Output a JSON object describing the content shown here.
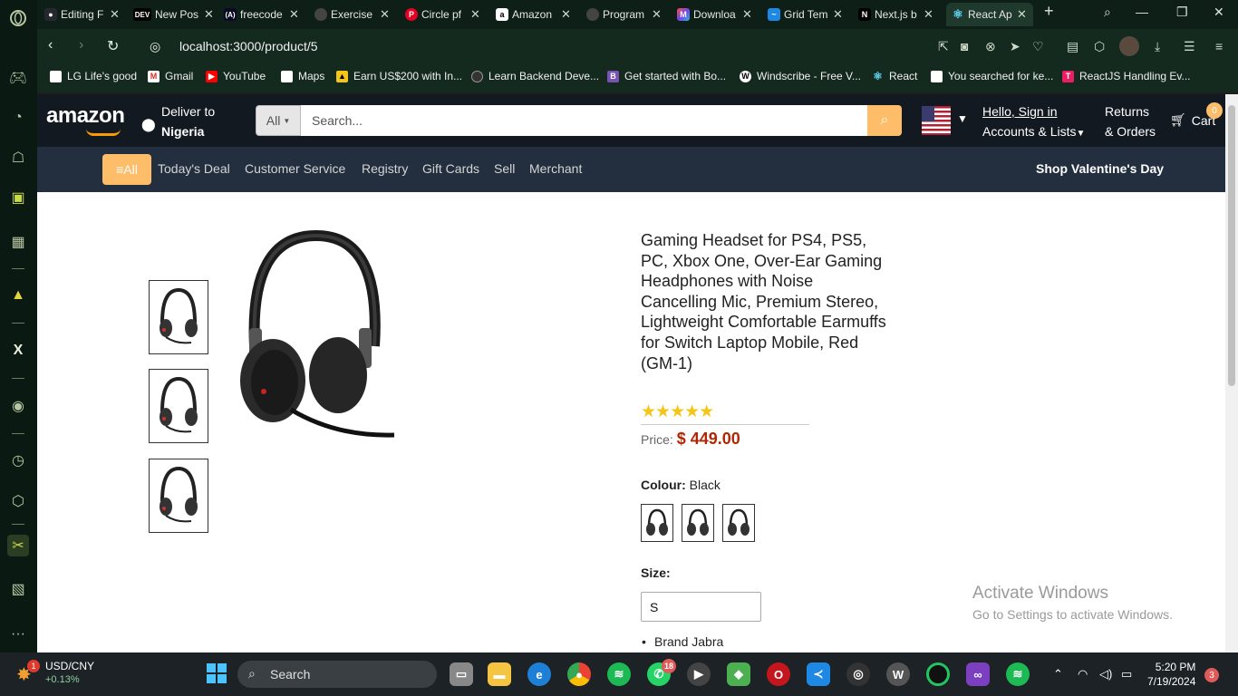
{
  "browser": {
    "tabs": [
      {
        "title": "Editing F",
        "icon": "github-icon",
        "color": "#24292e"
      },
      {
        "title": "New Pos",
        "icon": "dev-icon",
        "color": "#000000"
      },
      {
        "title": "freecode",
        "icon": "freecodecamp-icon",
        "color": "#0a0a23"
      },
      {
        "title": "Exercise",
        "icon": "exercise-icon",
        "color": "#444444"
      },
      {
        "title": "Circle pf",
        "icon": "pinterest-icon",
        "color": "#e60023"
      },
      {
        "title": "Amazon",
        "icon": "amazon-icon",
        "color": "#ffffff"
      },
      {
        "title": "Program",
        "icon": "program-icon",
        "color": "#444444"
      },
      {
        "title": "Downloa",
        "icon": "download-site-icon",
        "color": "#7a3ef0"
      },
      {
        "title": "Grid Tem",
        "icon": "grid-icon",
        "color": "#1e88e5"
      },
      {
        "title": "Next.js b",
        "icon": "nextjs-icon",
        "color": "#000000"
      },
      {
        "title": "React Ap",
        "icon": "react-icon",
        "color": "#61dafb"
      }
    ],
    "url": "localhost:3000/product/5",
    "bookmarks": [
      {
        "label": "LG Life's good",
        "icon": "page-icon"
      },
      {
        "label": "Gmail",
        "icon": "gmail-icon"
      },
      {
        "label": "YouTube",
        "icon": "youtube-icon"
      },
      {
        "label": "Maps",
        "icon": "page-icon"
      },
      {
        "label": "Earn US$200 with In...",
        "icon": "earn-icon"
      },
      {
        "label": "Learn Backend Deve...",
        "icon": "learn-icon"
      },
      {
        "label": "Get started with Bo...",
        "icon": "bootstrap-icon"
      },
      {
        "label": "Windscribe - Free V...",
        "icon": "windscribe-icon"
      },
      {
        "label": "React",
        "icon": "react-icon"
      },
      {
        "label": "You searched for ke...",
        "icon": "page-icon"
      },
      {
        "label": "ReactJS Handling Ev...",
        "icon": "reactjs-icon"
      }
    ]
  },
  "header": {
    "logo": "amazon",
    "deliver_line1": "Deliver to",
    "deliver_line2": "Nigeria",
    "search_category": "All",
    "search_placeholder": "Search...",
    "signin_line1": "Hello, Sign in",
    "signin_line2": "Accounts & Lists",
    "returns_line1": "Returns",
    "returns_line2": "& Orders",
    "cart_label": "Cart",
    "cart_count": "0",
    "all_button": "All",
    "nav_links": [
      "Today's Deal",
      "Customer Service",
      "Registry",
      "Gift Cards",
      "Sell",
      "Merchant"
    ],
    "promo": "Shop Valentine's Day"
  },
  "product": {
    "title": "Gaming Headset for PS4, PS5, PC, Xbox One, Over-Ear Gaming Headphones with Noise Cancelling Mic, Premium Stereo, Lightweight Comfortable Earmuffs for Switch Laptop Mobile, Red (GM-1)",
    "rating_stars": "★★★★★",
    "rating": 5,
    "price_label": "Price:",
    "price": "$ 449.00",
    "colour_label": "Colour:",
    "colour_value": "Black",
    "size_label": "Size:",
    "size_value": "S",
    "brand": "Brand Jabra"
  },
  "watermark": {
    "line1": "Activate Windows",
    "line2": "Go to Settings to activate Windows."
  },
  "taskbar": {
    "ticker_name": "USD/CNY",
    "ticker_change": "+0.13%",
    "ticker_badge": "1",
    "search": "Search",
    "whatsapp_badge": "18",
    "time": "5:20 PM",
    "date": "7/19/2024",
    "notif_count": "3"
  }
}
